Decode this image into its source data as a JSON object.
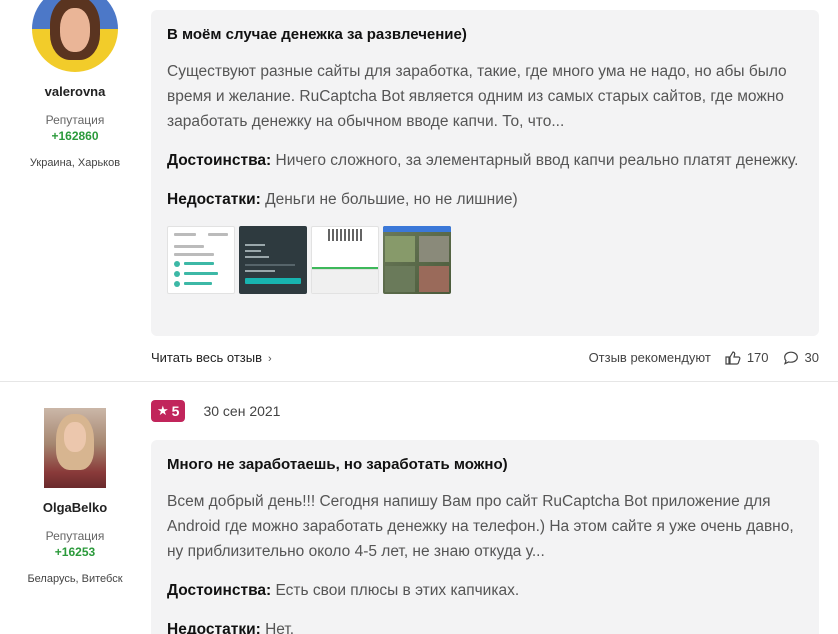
{
  "reviews": [
    {
      "author": {
        "name": "valerovna",
        "rep_label": "Репутация",
        "rep_value": "+162860",
        "location": "Украина, Харьков"
      },
      "title": "В моём случае денежка за развлечение)",
      "text": "Существуют разные сайты для заработка, такие, где много ума не надо, но абы было время и желание. RuCaptcha Bot является одним из самых старых сайтов, где можно заработать денежку на обычном вводе капчи. То, что...",
      "pros_label": "Достоинства:",
      "pros": "Ничего сложного, за элементарный ввод капчи реально платят денежку.",
      "cons_label": "Недостатки:",
      "cons": "Деньги не большие, но не лишние)",
      "read_more": "Читать весь отзыв",
      "recommend_label": "Отзыв рекомендуют",
      "likes": "170",
      "comments": "30"
    },
    {
      "author": {
        "name": "OlgaBelko",
        "rep_label": "Репутация",
        "rep_value": "+16253",
        "location": "Беларусь, Витебск"
      },
      "rating": "5",
      "date": "30 сен 2021",
      "title": "Много не заработаешь, но заработать можно)",
      "text": "Всем добрый день!!! Сегодня напишу Вам про сайт RuCaptcha Bot приложение для Android где можно заработать денежку на телефон.) На этом сайте я уже очень давно, ну приблизительно около 4-5 лет, не знаю откуда у...",
      "pros_label": "Достоинства:",
      "pros": "Есть свои плюсы в этих капчиках.",
      "cons_label": "Недостатки:",
      "cons": "Нет."
    }
  ],
  "colors": {
    "rating_badge": "#c1255b",
    "reputation": "#2b9a3b",
    "card_bg": "#f3f3f4"
  },
  "icons": {
    "like": "thumbs-up-icon",
    "comment": "comment-icon",
    "chevron": "chevron-right-icon",
    "star": "star-icon"
  }
}
